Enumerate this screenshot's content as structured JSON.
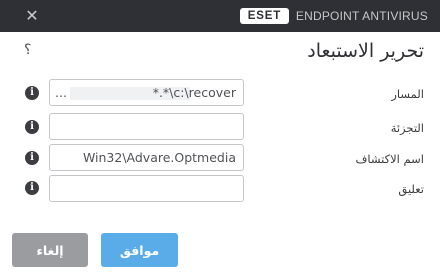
{
  "window": {
    "brand_logo": "ESET",
    "product_name": "ENDPOINT ANTIVIRUS",
    "close_glyph": "✕"
  },
  "dialog": {
    "title": "تحرير الاستبعاد",
    "help_glyph": "؟",
    "info_glyph": "i"
  },
  "fields": {
    "path": {
      "label": "المسار",
      "value": "*.*\\c:\\recover",
      "overflow": "..."
    },
    "hash": {
      "label": "التجزئة",
      "value": ""
    },
    "detection_name": {
      "label": "اسم الاكتشاف",
      "value": "Win32\\Advare.Optmedia"
    },
    "comment": {
      "label": "تعليق",
      "value": ""
    }
  },
  "buttons": {
    "ok": "موافق",
    "cancel": "إلغاء"
  },
  "colors": {
    "titlebar": "#2e3035",
    "primary_button": "#5aace8",
    "secondary_button": "#9a9ca0"
  },
  "icons": [
    "close-icon",
    "help-icon",
    "info-icon"
  ]
}
